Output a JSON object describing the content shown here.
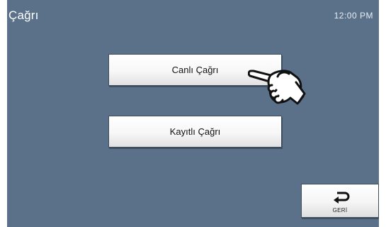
{
  "header": {
    "title": "Çağrı",
    "time": "12:00 PM"
  },
  "menu": {
    "live_call_label": "Canlı Çağrı",
    "recorded_call_label": "Kayıtlı Çağrı"
  },
  "footer": {
    "back_label": "GERİ",
    "back_icon": "return-arrow-icon"
  },
  "overlay": {
    "pointer_icon": "pointing-hand-icon"
  },
  "colors": {
    "background": "#5a7189",
    "button": "#f5f5f5",
    "text": "#111111"
  }
}
